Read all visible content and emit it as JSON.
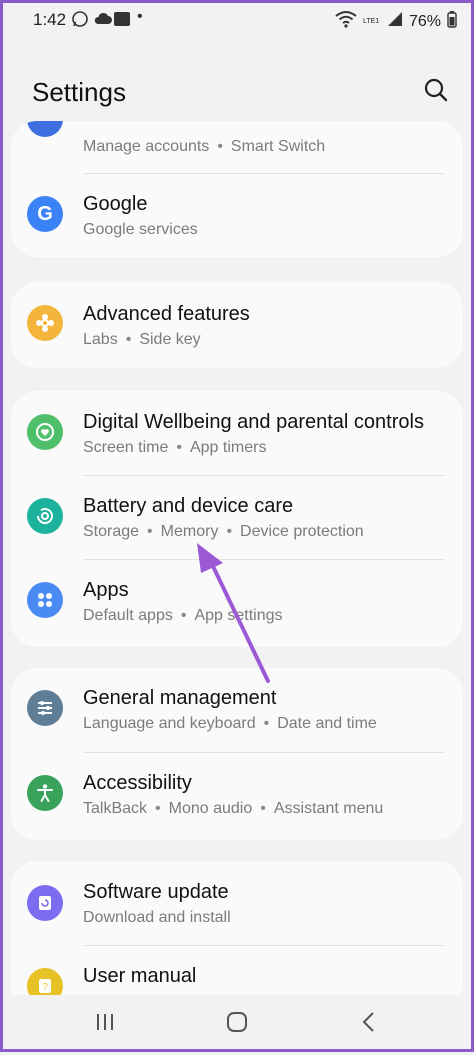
{
  "status_bar": {
    "time": "1:42",
    "battery": "76%",
    "network_label": "LTE1"
  },
  "header": {
    "title": "Settings"
  },
  "partial_item": {
    "subtitle": [
      "Manage accounts",
      "Smart Switch"
    ]
  },
  "items": {
    "google": {
      "title": "Google",
      "subtitle": [
        "Google services"
      ]
    },
    "advanced": {
      "title": "Advanced features",
      "subtitle": [
        "Labs",
        "Side key"
      ]
    },
    "wellbeing": {
      "title": "Digital Wellbeing and parental controls",
      "subtitle": [
        "Screen time",
        "App timers"
      ]
    },
    "battery": {
      "title": "Battery and device care",
      "subtitle": [
        "Storage",
        "Memory",
        "Device protection"
      ]
    },
    "apps": {
      "title": "Apps",
      "subtitle": [
        "Default apps",
        "App settings"
      ]
    },
    "general": {
      "title": "General management",
      "subtitle": [
        "Language and keyboard",
        "Date and time"
      ]
    },
    "accessibility": {
      "title": "Accessibility",
      "subtitle": [
        "TalkBack",
        "Mono audio",
        "Assistant menu"
      ]
    },
    "software": {
      "title": "Software update",
      "subtitle": [
        "Download and install"
      ]
    },
    "manual": {
      "title": "User manual",
      "subtitle": []
    }
  },
  "colors": {
    "accent_border": "#8b5cc9",
    "arrow": "#9b59d6",
    "google": "#3b82f6",
    "advanced": "#f4b63a",
    "wellbeing": "#4fbf6a",
    "battery": "#1cb39d",
    "apps": "#4a8af4",
    "general": "#5f7d95",
    "accessibility": "#3aa35b",
    "software": "#7b6cf0",
    "manual": "#e6c226"
  }
}
